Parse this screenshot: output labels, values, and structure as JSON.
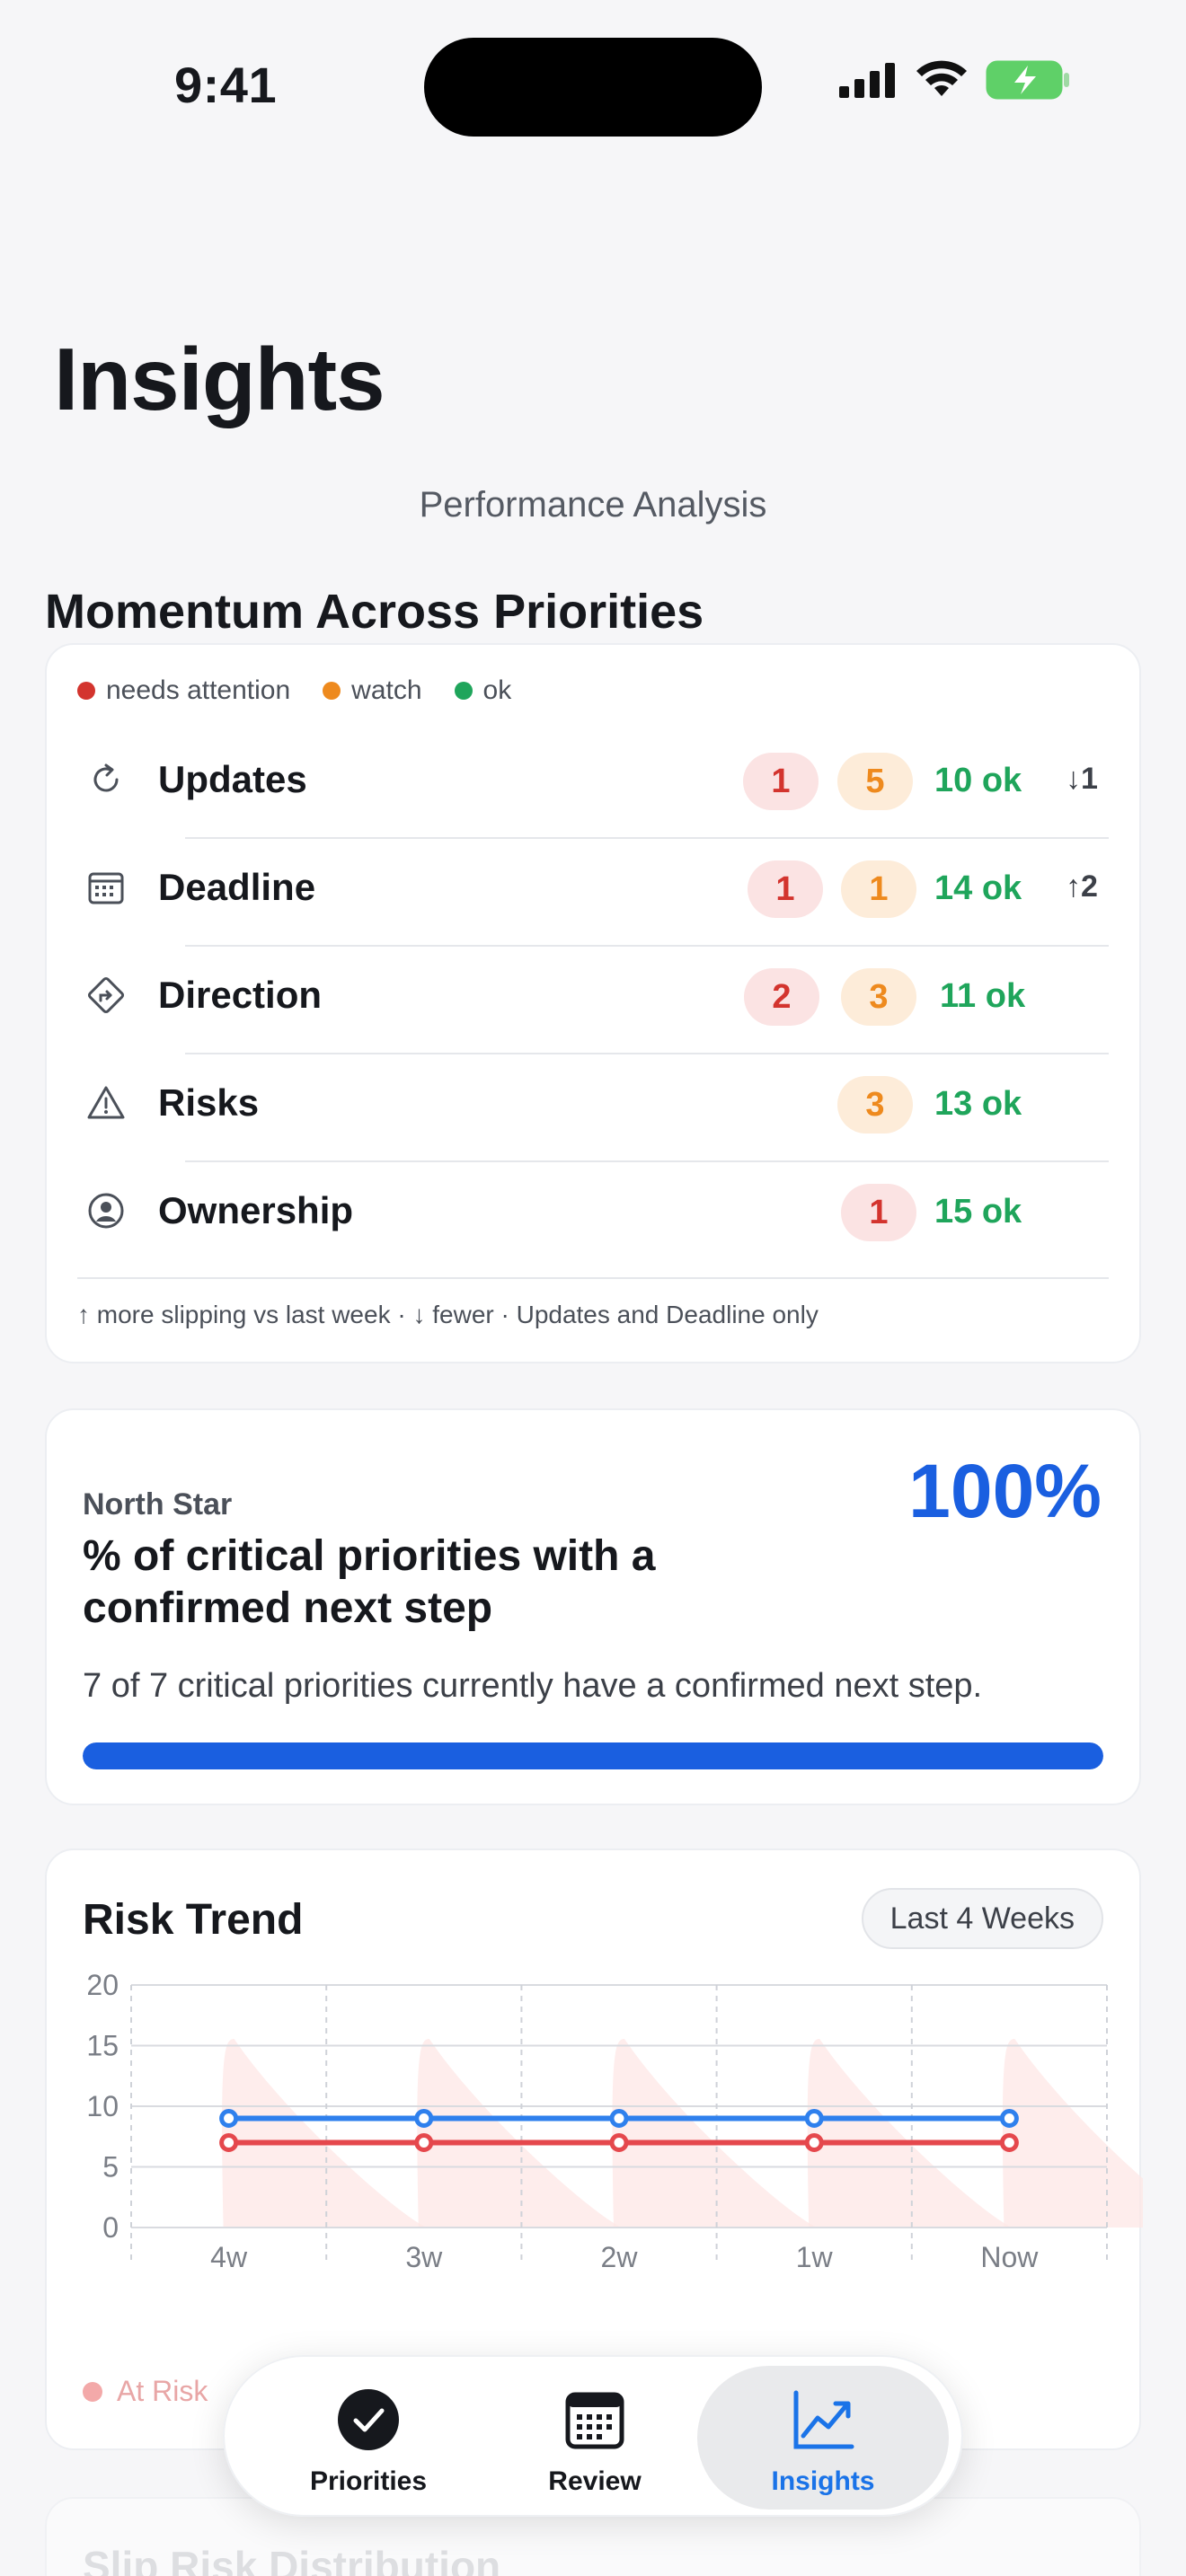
{
  "status": {
    "time": "9:41"
  },
  "page": {
    "title": "Insights",
    "subtitle": "Performance Analysis"
  },
  "momentum": {
    "section_title": "Momentum Across Priorities",
    "legend": [
      {
        "label": "needs attention",
        "color": "#d3342e"
      },
      {
        "label": "watch",
        "color": "#ee8a1e"
      },
      {
        "label": "ok",
        "color": "#1fa55b"
      }
    ],
    "rows": [
      {
        "icon": "refresh-icon",
        "name": "Updates",
        "red": "1",
        "amber": "5",
        "ok": "10 ok",
        "trend": "↓1"
      },
      {
        "icon": "calendar-icon",
        "name": "Deadline",
        "red": "1",
        "amber": "1",
        "ok": "14 ok",
        "trend": "↑2"
      },
      {
        "icon": "direction-icon",
        "name": "Direction",
        "red": "2",
        "amber": "3",
        "ok": "11 ok",
        "trend": ""
      },
      {
        "icon": "warning-icon",
        "name": "Risks",
        "red": "",
        "amber": "3",
        "ok": "13 ok",
        "trend": ""
      },
      {
        "icon": "person-icon",
        "name": "Ownership",
        "red": "1",
        "amber": "",
        "ok": "15 ok",
        "trend": ""
      }
    ],
    "footnote": "↑ more slipping vs last week · ↓ fewer · Updates and Deadline only"
  },
  "north_star": {
    "label": "North Star",
    "title": "% of critical priorities with a confirmed next step",
    "percent_text": "100%",
    "progress": 1.0,
    "description": "7 of 7 critical priorities currently have a confirmed next step."
  },
  "risk_trend": {
    "title": "Risk Trend",
    "range_label": "Last 4 Weeks",
    "legend_label": "At Risk"
  },
  "chart_data": {
    "type": "line",
    "title": "Risk Trend",
    "categories": [
      "4w",
      "3w",
      "2w",
      "1w",
      "Now"
    ],
    "y_ticks": [
      "20",
      "15",
      "10",
      "5",
      "0"
    ],
    "ylim": [
      0,
      20
    ],
    "grid": true,
    "series": [
      {
        "name": "",
        "color": "#2f80ed",
        "values": [
          9,
          9,
          9,
          9,
          9
        ]
      },
      {
        "name": "At Risk",
        "color": "#e5484d",
        "values": [
          7,
          7,
          7,
          7,
          7
        ]
      }
    ]
  },
  "next_section": {
    "title": "Slip Risk Distribution"
  },
  "tabbar": {
    "tabs": [
      {
        "label": "Priorities",
        "icon": "check-circle-icon"
      },
      {
        "label": "Review",
        "icon": "calendar-icon"
      },
      {
        "label": "Insights",
        "icon": "chart-icon"
      }
    ]
  }
}
